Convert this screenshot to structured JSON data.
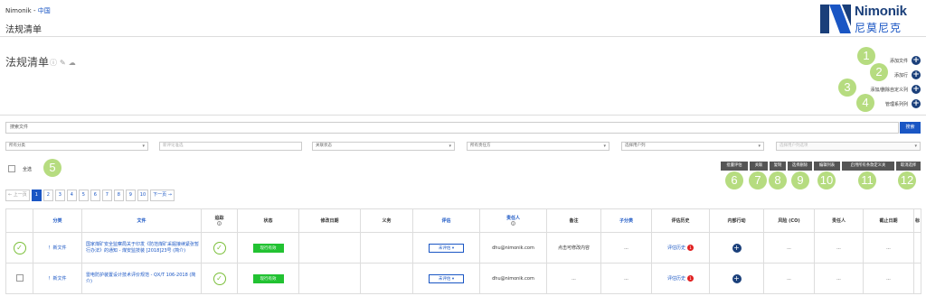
{
  "breadcrumb": {
    "org": "Nimonik",
    "sep": " - ",
    "location": "中国"
  },
  "page_title": "法规清单",
  "logo": {
    "en": "Nimonik",
    "cn": "尼莫尼克"
  },
  "heading": "法规清单",
  "actions": [
    {
      "label": "添加文件",
      "badge": "1"
    },
    {
      "label": "添加行",
      "badge": "2"
    },
    {
      "label": "添加/删除自定义列",
      "badge": "3"
    },
    {
      "label": "管理系列列",
      "badge": "4"
    }
  ],
  "search": {
    "placeholder": "搜索文件",
    "button": "搜索"
  },
  "filters": {
    "category": "所有分类",
    "tag_input": "新评论准选",
    "relation": "关联状态",
    "responsible": "所有责任方",
    "user_column": "选择用户列",
    "user_column_disabled": "选择用户列选项"
  },
  "select_all": {
    "label": "全选",
    "badge": "5"
  },
  "tools": [
    {
      "label": "批量评估",
      "badge": "6"
    },
    {
      "label": "关联",
      "badge": "7"
    },
    {
      "label": "复制",
      "badge": "8"
    },
    {
      "label": "选择删除",
      "badge": "9"
    },
    {
      "label": "编辑列表",
      "badge": "10"
    },
    {
      "label": "启用所有条款定义关",
      "badge": "11"
    },
    {
      "label": "取消选择",
      "badge": "12"
    }
  ],
  "pagination": {
    "prev": "← 上一页",
    "pages": [
      "1",
      "2",
      "3",
      "4",
      "5",
      "6",
      "7",
      "8",
      "9",
      "10"
    ],
    "next": "下一页 →",
    "current": "1"
  },
  "table": {
    "headers": [
      "",
      "分类",
      "文件",
      "追踪",
      "状态",
      "修改日期",
      "义务",
      "评估",
      "责任人",
      "备注",
      "子分类",
      "评估历史",
      "内部行动",
      "风险 (CO)",
      "责任人",
      "截止日期",
      "标"
    ],
    "rows": [
      {
        "category": "！新文件",
        "document": "国家煤矿安全监察局关于印发《防范煤矿采掘接续紧张暂行办法》的通知 - 煤安监技装 [2018]23号 (简介)",
        "status": "现行有效",
        "evaluation": "未评估 ▾",
        "responsible": "dhu@nimonik.com",
        "note": "点击可修改内容",
        "subcategory": "...",
        "history": "评估历史",
        "history_count": "1",
        "risk": "...",
        "owner": "...",
        "due": "..."
      },
      {
        "category": "！新文件",
        "document": "雷电防护装置设计技术评价规范 - QX/T 106-2018 (简介)",
        "status": "现行有效",
        "evaluation": "未评估 ▾",
        "responsible": "dhu@nimonik.com",
        "note": "...",
        "subcategory": "...",
        "history": "评估历史",
        "history_count": "1",
        "risk": "...",
        "owner": "...",
        "due": "..."
      }
    ]
  },
  "colors": {
    "accent": "#1a56c4",
    "brand": "#1a3f7a",
    "badge": "#b6dc80",
    "status": "#22c232"
  }
}
